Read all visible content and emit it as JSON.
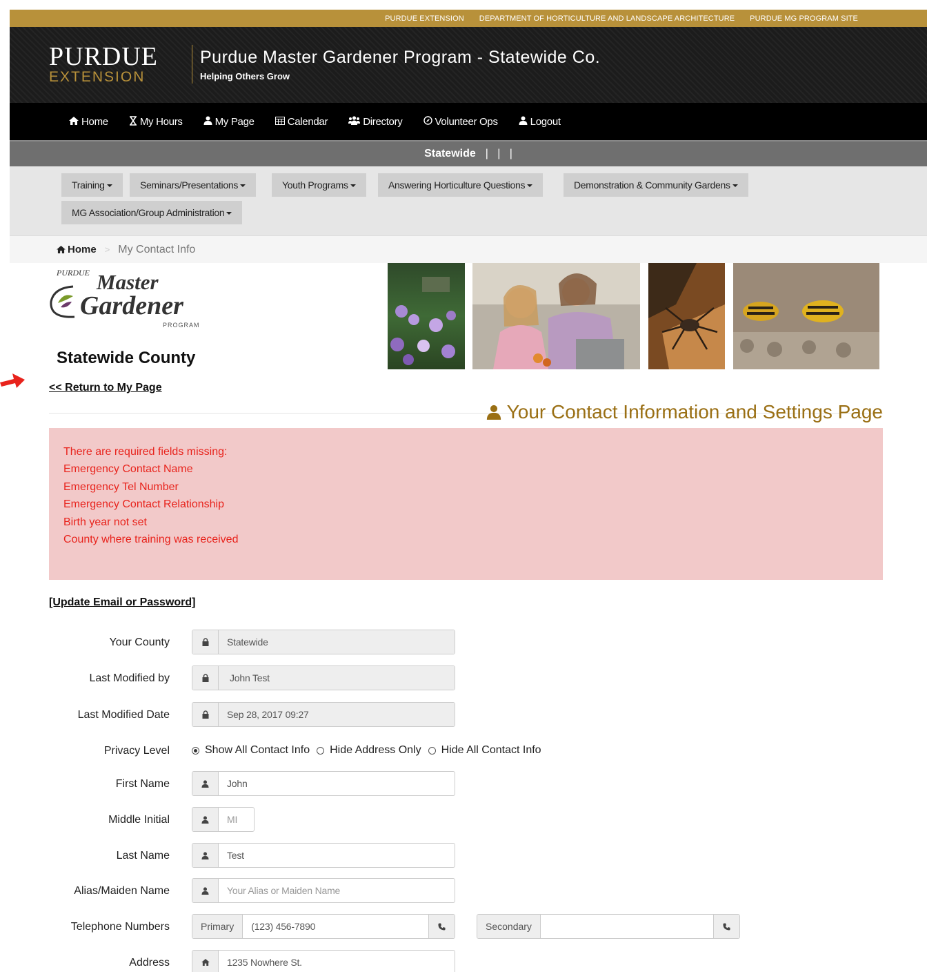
{
  "utility_links": [
    "PURDUE EXTENSION",
    "DEPARTMENT OF HORTICULTURE AND LANDSCAPE ARCHITECTURE",
    "PURDUE MG PROGRAM SITE"
  ],
  "brand": {
    "logo_top": "PURDUE",
    "logo_bottom": "EXTENSION",
    "title": "Purdue Master Gardener Program - Statewide Co.",
    "tagline": "Helping Others Grow"
  },
  "main_nav": [
    {
      "label": "Home",
      "icon": "home-icon"
    },
    {
      "label": "My Hours",
      "icon": "hourglass-icon"
    },
    {
      "label": "My Page",
      "icon": "user-icon"
    },
    {
      "label": "Calendar",
      "icon": "calendar-icon"
    },
    {
      "label": "Directory",
      "icon": "group-icon"
    },
    {
      "label": "Volunteer Ops",
      "icon": "compass-icon"
    },
    {
      "label": "Logout",
      "icon": "user-icon"
    }
  ],
  "county_bar": {
    "label": "Statewide",
    "separators": "|   |   |"
  },
  "sub_menu": [
    "Training",
    "Seminars/Presentations",
    "Youth Programs",
    "Answering Horticulture Questions",
    "Demonstration & Community Gardens",
    "MG Association/Group Administration"
  ],
  "breadcrumb": {
    "home": "Home",
    "current": "My Contact Info"
  },
  "mg_logo": {
    "arc": "PURDUE",
    "line1": "Master",
    "line2": "Gardener",
    "line3": "PROGRAM"
  },
  "county_title": "Statewide County",
  "return_link": "<< Return to My Page",
  "page_heading": "Your Contact Information and Settings Page",
  "alert_lines": [
    "There are required fields missing:",
    "Emergency Contact Name",
    "Emergency Tel Number",
    "Emergency Contact Relationship",
    "Birth year not set",
    "County where training was received"
  ],
  "update_link": "[Update Email or Password]",
  "form": {
    "county": {
      "label": "Your County",
      "value": "Statewide"
    },
    "modified_by": {
      "label": "Last Modified by",
      "value": "John Test"
    },
    "modified_date": {
      "label": "Last Modified Date",
      "value": "Sep 28, 2017 09:27"
    },
    "privacy": {
      "label": "Privacy Level",
      "options": [
        "Show All Contact Info",
        "Hide Address Only",
        "Hide All Contact Info"
      ],
      "selected": "Show All Contact Info"
    },
    "first_name": {
      "label": "First Name",
      "value": "John"
    },
    "middle_initial": {
      "label": "Middle Initial",
      "placeholder": "MI"
    },
    "last_name": {
      "label": "Last Name",
      "value": "Test"
    },
    "alias": {
      "label": "Alias/Maiden Name",
      "placeholder": "Your Alias or Maiden Name"
    },
    "telephone": {
      "label": "Telephone Numbers",
      "primary_label": "Primary",
      "primary_value": "(123) 456-7890",
      "secondary_label": "Secondary",
      "secondary_value": ""
    },
    "address": {
      "label": "Address",
      "value": "1235 Nowhere St."
    }
  },
  "colors": {
    "gold": "#b8913a",
    "heading": "#9a6f14",
    "alert_bg": "#f2c9c9",
    "alert_text": "#e8231c"
  }
}
